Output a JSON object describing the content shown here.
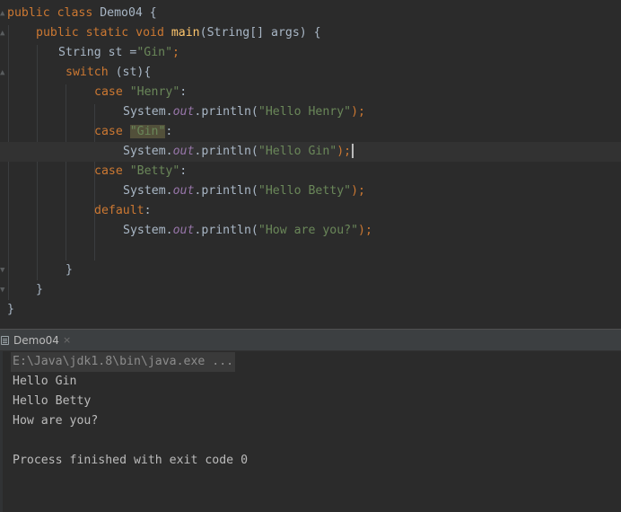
{
  "editor": {
    "lines": [
      {
        "t1": "public class ",
        "t2": "Demo04 {"
      },
      {
        "t1": "public static void ",
        "t2": "main",
        "t3": "(String[] args) {"
      },
      {
        "t1": "String st =",
        "t2": "\"Gin\"",
        "t3": ";"
      },
      {
        "t1": "switch",
        "t2": " (st){"
      },
      {
        "t1": "case ",
        "t2": "\"Henry\"",
        "t3": ":"
      },
      {
        "t1": "System.",
        "t2": "out",
        "t3": ".println(",
        "t4": "\"Hello Henry\"",
        "t5": ");"
      },
      {
        "t1": "case ",
        "t2": "\"Gin\"",
        "t3": ":"
      },
      {
        "t1": "System.",
        "t2": "out",
        "t3": ".println(",
        "t4": "\"Hello Gin\"",
        "t5": ");"
      },
      {
        "t1": "case ",
        "t2": "\"Betty\"",
        "t3": ":"
      },
      {
        "t1": "System.",
        "t2": "out",
        "t3": ".println(",
        "t4": "\"Hello Betty\"",
        "t5": ");"
      },
      {
        "t1": "default",
        "t2": ":"
      },
      {
        "t1": "System.",
        "t2": "out",
        "t3": ".println(",
        "t4": "\"How are you?\"",
        "t5": ");"
      },
      {
        "t1": "}"
      },
      {
        "t1": "}"
      },
      {
        "t1": "}"
      }
    ]
  },
  "run_tab": {
    "label": "Demo04",
    "close": "×"
  },
  "console": {
    "command": "E:\\Java\\jdk1.8\\bin\\java.exe ...",
    "output": [
      "Hello Gin",
      "Hello Betty",
      "How are you?"
    ],
    "exit": "Process finished with exit code 0"
  },
  "colors": {
    "background": "#2b2b2b",
    "keyword": "#cc7832",
    "method": "#ffc66d",
    "string": "#6a8759",
    "field": "#9876aa",
    "text": "#a9b7c6"
  },
  "icons": [
    "fold-marker-icon",
    "run-console-icon",
    "close-icon"
  ]
}
